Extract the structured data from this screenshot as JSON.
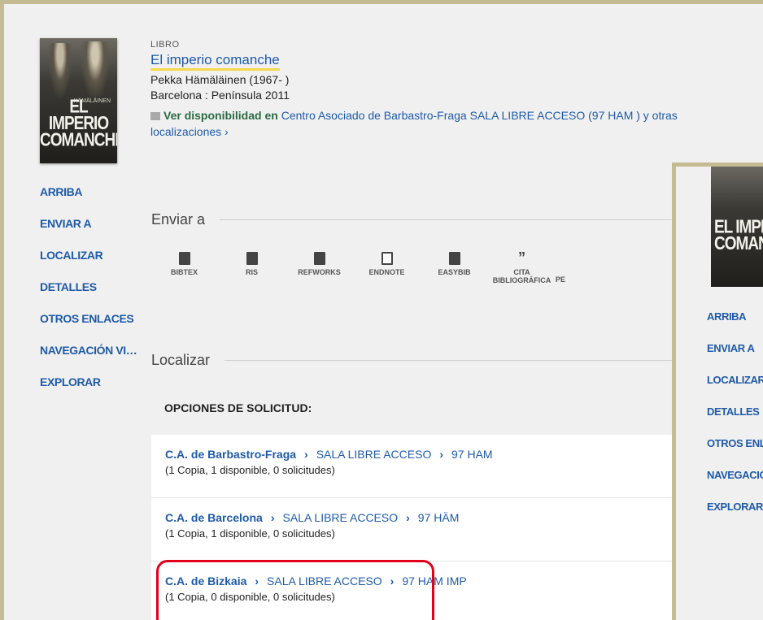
{
  "record": {
    "type": "LIBRO",
    "title": "El imperio comanche",
    "author": "Pekka Hämäläinen (1967- )",
    "publication": "Barcelona : Península 2011",
    "availability_label": "Ver disponibilidad en",
    "availability_location": "Centro Asociado de Barbastro-Fraga  SALA LIBRE ACCESO (97 HAM ) y otras",
    "availability_more": "localizaciones ›",
    "cover_title": "EL IMPERIO COMANCHE",
    "cover_author": "HÄMÄLÄINEN"
  },
  "nav": {
    "items": [
      "ARRIBA",
      "ENVIAR A",
      "LOCALIZAR",
      "DETALLES",
      "OTROS ENLACES",
      "NAVEGACIÓN VI…",
      "EXPLORAR"
    ]
  },
  "send_to": {
    "heading": "Enviar a",
    "items": [
      {
        "label": "BIBTEX",
        "icon": "bibtex-icon"
      },
      {
        "label": "RIS",
        "icon": "ris-icon"
      },
      {
        "label": "REFWORKS",
        "icon": "refworks-icon"
      },
      {
        "label": "ENDNOTE",
        "icon": "endnote-icon"
      },
      {
        "label": "EASYBIB",
        "icon": "easybib-icon"
      },
      {
        "label": "CITA BIBLIOGRÁFICA",
        "icon": "quote-icon"
      },
      {
        "label": "PE",
        "icon": "permalink-icon"
      }
    ]
  },
  "locate": {
    "heading": "Localizar",
    "options_label": "OPCIONES DE SOLICITUD:",
    "locations": [
      {
        "library": "C.A. de Barbastro-Fraga",
        "collection": "SALA LIBRE ACCESO",
        "callno": "97 HAM",
        "status": "(1 Copia, 1 disponible, 0 solicitudes)"
      },
      {
        "library": "C.A. de Barcelona",
        "collection": "SALA LIBRE ACCESO",
        "callno": "97 HÄM",
        "status": "(1 Copia, 1 disponible, 0 solicitudes)"
      },
      {
        "library": "C.A. de Bizkaia",
        "collection": "SALA LIBRE ACCESO",
        "callno": "97 HAM IMP",
        "status": "(1 Copia, 0 disponible, 0 solicitudes)"
      }
    ]
  },
  "overlay": {
    "cover_title": "EL IMPERIO COMANCHE",
    "nav": [
      "ARRIBA",
      "ENVIAR A",
      "LOCALIZAR",
      "DETALLES",
      "OTROS ENLACES",
      "NAVEGACIÓN",
      "EXPLORAR"
    ]
  },
  "colors": {
    "link": "#1f5aa8",
    "highlight": "#f5d94a",
    "available": "#2b6a43",
    "annotation": "#e3001b"
  }
}
